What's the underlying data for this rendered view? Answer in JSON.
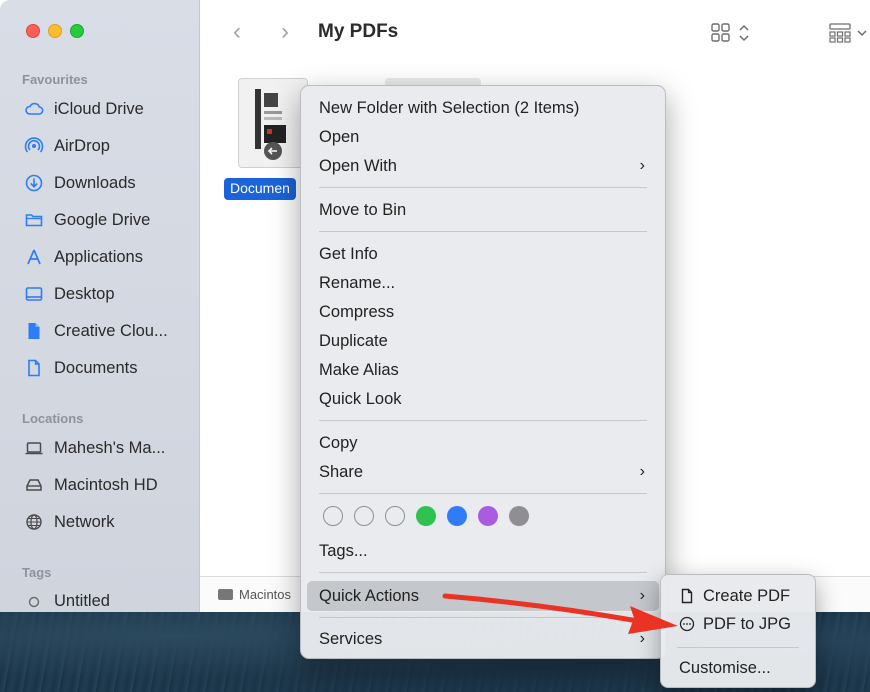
{
  "window": {
    "title": "My PDFs"
  },
  "sidebar": {
    "sections": [
      {
        "label": "Favourites",
        "items": [
          {
            "label": "iCloud Drive",
            "icon": "cloud-icon"
          },
          {
            "label": "AirDrop",
            "icon": "airdrop-icon"
          },
          {
            "label": "Downloads",
            "icon": "download-icon"
          },
          {
            "label": "Google Drive",
            "icon": "folder-icon"
          },
          {
            "label": "Applications",
            "icon": "applications-icon"
          },
          {
            "label": "Desktop",
            "icon": "desktop-icon"
          },
          {
            "label": "Creative Clou...",
            "icon": "file-icon"
          },
          {
            "label": "Documents",
            "icon": "document-icon"
          }
        ]
      },
      {
        "label": "Locations",
        "items": [
          {
            "label": "Mahesh's Ma...",
            "icon": "laptop-icon"
          },
          {
            "label": "Macintosh HD",
            "icon": "disk-icon"
          },
          {
            "label": "Network",
            "icon": "network-icon"
          }
        ]
      },
      {
        "label": "Tags",
        "items": [
          {
            "label": "Untitled",
            "icon": "tag-circle-icon"
          }
        ]
      }
    ]
  },
  "content": {
    "selected_file_label": "Documen",
    "pathbar_label": "Macintos"
  },
  "context_menu": {
    "items": {
      "new_folder": "New Folder with Selection (2 Items)",
      "open": "Open",
      "open_with": "Open With",
      "move_to_bin": "Move to Bin",
      "get_info": "Get Info",
      "rename": "Rename...",
      "compress": "Compress",
      "duplicate": "Duplicate",
      "make_alias": "Make Alias",
      "quick_look": "Quick Look",
      "copy": "Copy",
      "share": "Share",
      "tags": "Tags...",
      "quick_actions": "Quick Actions",
      "services": "Services"
    },
    "tag_colors": [
      "empty",
      "empty",
      "empty",
      "#2fc24e",
      "#2f7cf6",
      "#a95ce0",
      "#8e8e93"
    ]
  },
  "quick_actions_submenu": {
    "create_pdf": "Create PDF",
    "pdf_to_jpg": "PDF to JPG",
    "customise": "Customise..."
  },
  "colors": {
    "accent": "#1a63d8",
    "annotation_arrow": "#ea3323"
  }
}
